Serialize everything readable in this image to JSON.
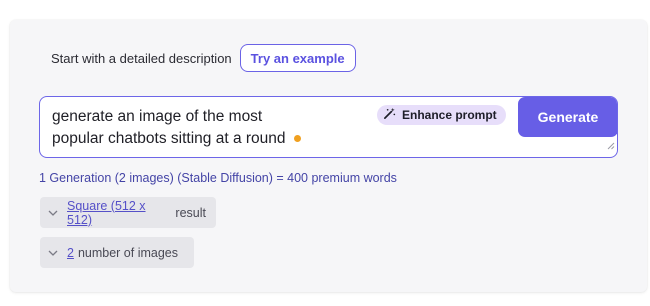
{
  "intro": {
    "label": "Start with a detailed description",
    "example_button": "Try an example"
  },
  "prompt": {
    "line1": "generate an image of the most",
    "line2": "popular chatbots sitting at a round",
    "enhance_label": "Enhance prompt",
    "generate_label": "Generate"
  },
  "cost_text": "1 Generation (2 images) (Stable Diffusion) = 400 premium words",
  "options": {
    "size": {
      "value": "Square (512 x 512)",
      "suffix": "result"
    },
    "count": {
      "value": "2",
      "suffix": "number of images"
    }
  },
  "colors": {
    "accent": "#675ee6",
    "enhance_bg": "#e7defa",
    "dot": "#f0a020",
    "card_bg": "#f6f6f8"
  },
  "icons": [
    "magic-wand-icon",
    "chevron-down-icon",
    "resize-handle-icon"
  ]
}
